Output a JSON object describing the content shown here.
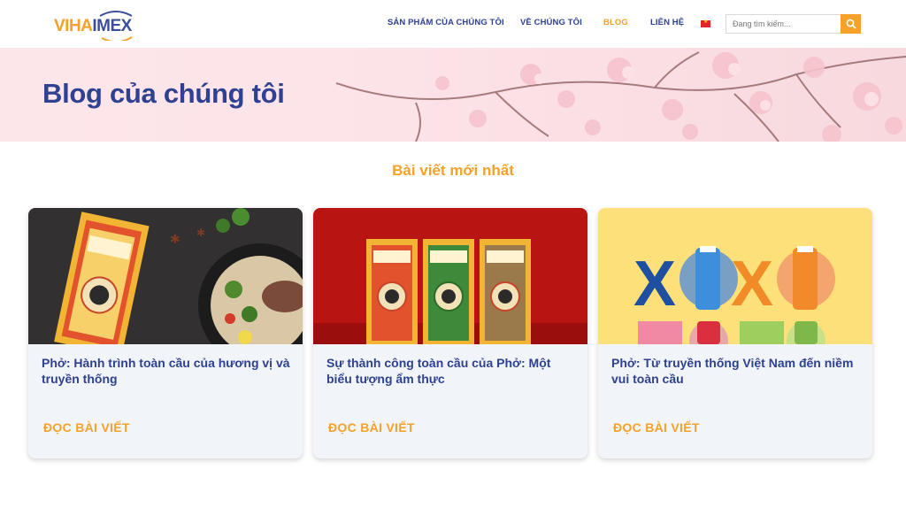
{
  "header": {
    "logo": {
      "part1": "VIHA",
      "part2": "IMEX"
    },
    "nav": [
      {
        "label": "SẢN PHẨM CỦA CHÚNG TÔI",
        "active": false
      },
      {
        "label": "VỀ CHÚNG TÔI",
        "active": false
      },
      {
        "label": "BLOG",
        "active": true
      },
      {
        "label": "LIÊN HỆ",
        "active": false
      }
    ],
    "search": {
      "placeholder": "Đang tìm kiếm..."
    }
  },
  "hero": {
    "title": "Blog của chúng tôi"
  },
  "section": {
    "title": "Bài viết mới nhất"
  },
  "cards": [
    {
      "title": "Phở: Hành trình toàn cầu của hương vị và truyền thống",
      "link": "ĐỌC BÀI VIẾT"
    },
    {
      "title": "Sự thành công toàn cầu của Phở: Một biểu tượng ẩm thực",
      "link": "ĐỌC BÀI VIẾT"
    },
    {
      "title": "Phở: Từ truyền thống Việt Nam đến niềm vui toàn cầu",
      "link": "ĐỌC BÀI VIẾT"
    }
  ],
  "colors": {
    "brand_blue": "#2f4191",
    "accent_orange": "#f5a12a",
    "hero_pink": "#fce3e8"
  }
}
